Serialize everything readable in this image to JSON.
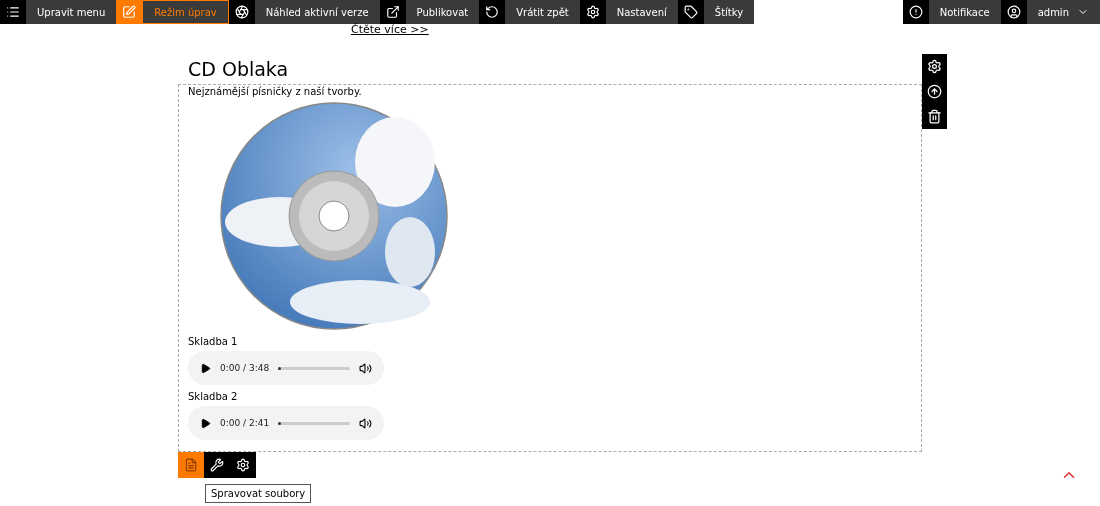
{
  "toolbar": {
    "left": [
      {
        "label": "Upravit menu",
        "selected": false
      },
      {
        "label": "Režim úprav",
        "selected": true
      },
      {
        "label": "Náhled aktivní verze",
        "selected": false
      },
      {
        "label": "Publikovat",
        "selected": false
      },
      {
        "label": "Vrátit zpět",
        "selected": false
      },
      {
        "label": "Nastavení",
        "selected": false
      },
      {
        "label": "Štítky",
        "selected": false
      }
    ],
    "right": [
      {
        "label": "Notifikace"
      },
      {
        "label": "admin"
      }
    ]
  },
  "read_more_link": "Čtěte více >>",
  "article": {
    "title": "CD Oblaka",
    "description": "Nejznámější písničky z naší tvorby.",
    "tracks": [
      {
        "name": "Skladba 1",
        "time": "0:00 / 3:48",
        "level": 0
      },
      {
        "name": "Skladba 2",
        "time": "0:00 / 2:41",
        "level": 0
      }
    ]
  },
  "bottom_tools": [
    {
      "selected": true
    },
    {
      "selected": false
    },
    {
      "selected": false
    }
  ],
  "tooltip": "Spravovat soubory"
}
